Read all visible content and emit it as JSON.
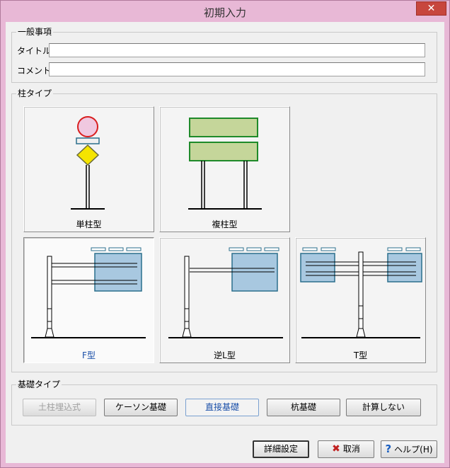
{
  "window": {
    "title": "初期入力",
    "close_icon": "✕"
  },
  "general": {
    "legend": "一般事項",
    "title_label": "タイトル",
    "title_value": "",
    "comment_label": "コメント",
    "comment_value": ""
  },
  "pillar_type": {
    "legend": "柱タイプ",
    "options": [
      {
        "label": "単柱型"
      },
      {
        "label": "複柱型"
      },
      {
        "label": "F型"
      },
      {
        "label": "逆L型"
      },
      {
        "label": "T型"
      }
    ],
    "selected": "F型"
  },
  "foundation_type": {
    "legend": "基礎タイプ",
    "buttons": [
      {
        "label": "土柱埋込式",
        "state": "disabled"
      },
      {
        "label": "ケーソン基礎",
        "state": "normal"
      },
      {
        "label": "直接基礎",
        "state": "active"
      },
      {
        "label": "杭基礎",
        "state": "normal"
      },
      {
        "label": "計算しない",
        "state": "normal"
      }
    ]
  },
  "footer": {
    "detail_label": "詳細設定",
    "cancel_label": "取消",
    "help_label": "ヘルプ(H)"
  },
  "colors": {
    "accent": "#1a4fa8",
    "sign_green": "#c5d69a",
    "sign_blue": "#a8c8e0",
    "round_sign": "#f0c8e0",
    "diamond_sign": "#f5e400"
  }
}
